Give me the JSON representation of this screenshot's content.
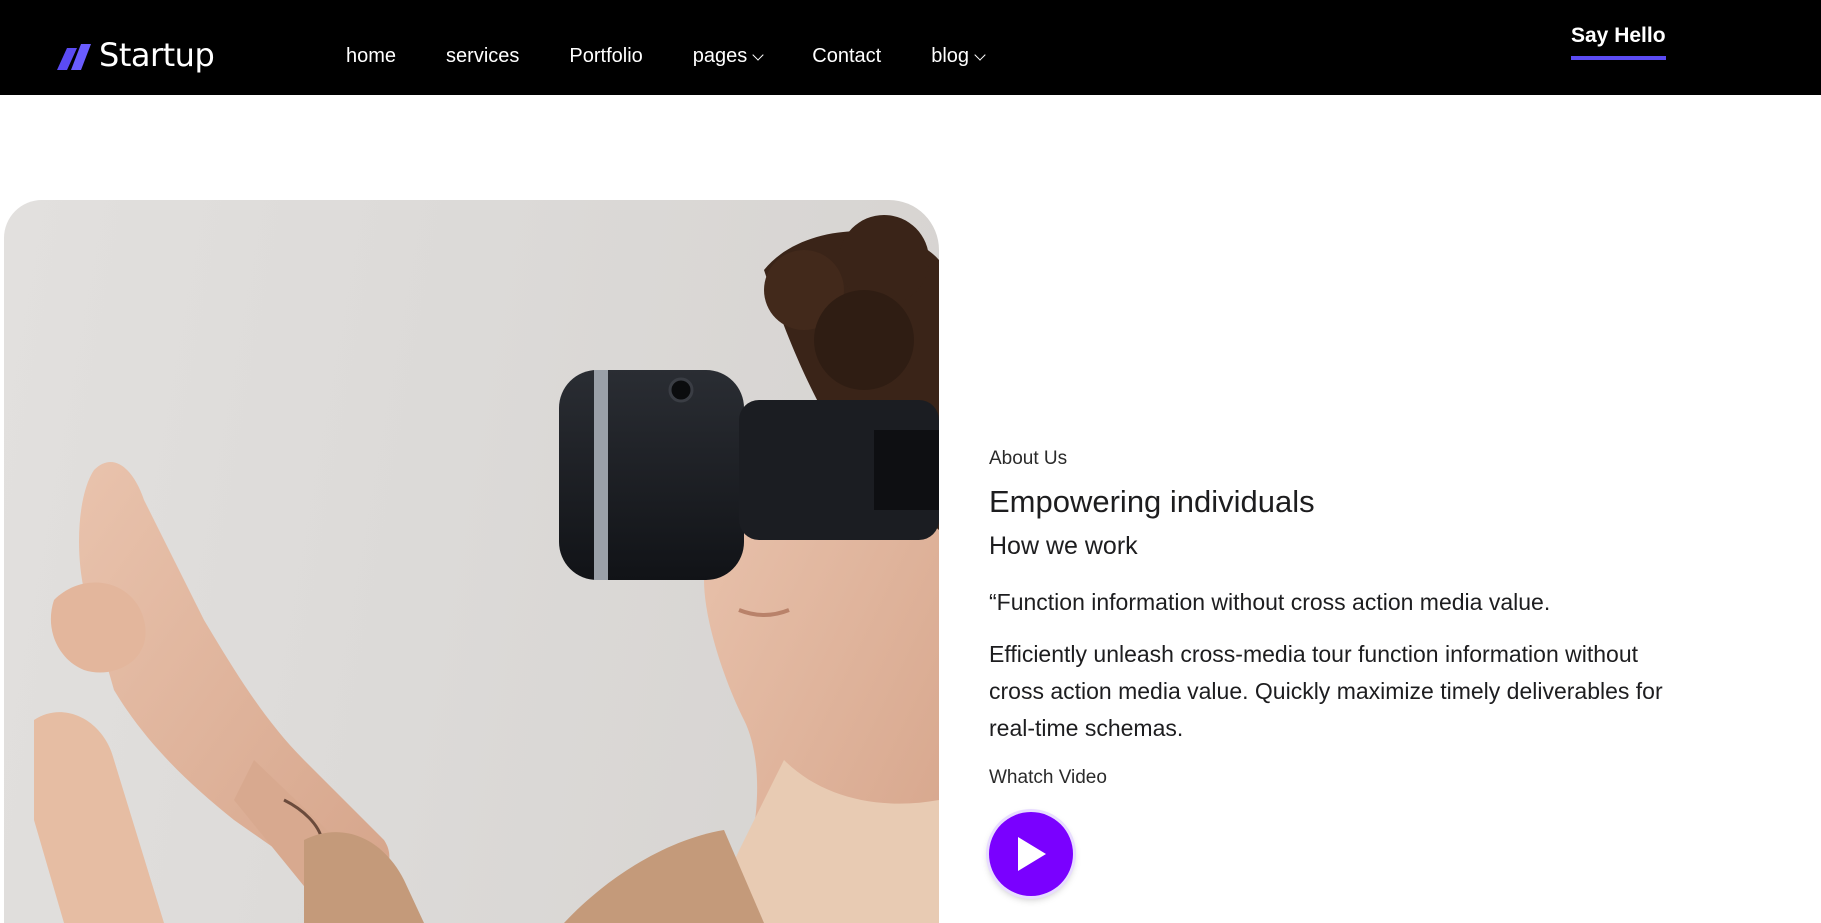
{
  "header": {
    "brand": "Startup",
    "nav": [
      {
        "label": "home"
      },
      {
        "label": "services"
      },
      {
        "label": "Portfolio"
      },
      {
        "label": "pages"
      },
      {
        "label": "Contact"
      },
      {
        "label": "blog"
      }
    ],
    "cta_label": "Say Hello"
  },
  "about": {
    "eyebrow": "About Us",
    "headline": "Empowering individuals",
    "subhead": "How we work",
    "quote": "“Function information without cross action media value.",
    "paragraph": "Efficiently unleash cross-media tour function information without cross action media value. Quickly maximize timely deliverables for real-time schemas.",
    "video_label": "Whatch Video"
  },
  "colors": {
    "header_bg": "#000000",
    "accent": "#5b4bf3",
    "play_button": "#7a00ff"
  },
  "icons": {
    "logo": "startup-logo-icon",
    "dropdown": "chevron-down-icon",
    "play": "play-icon"
  }
}
